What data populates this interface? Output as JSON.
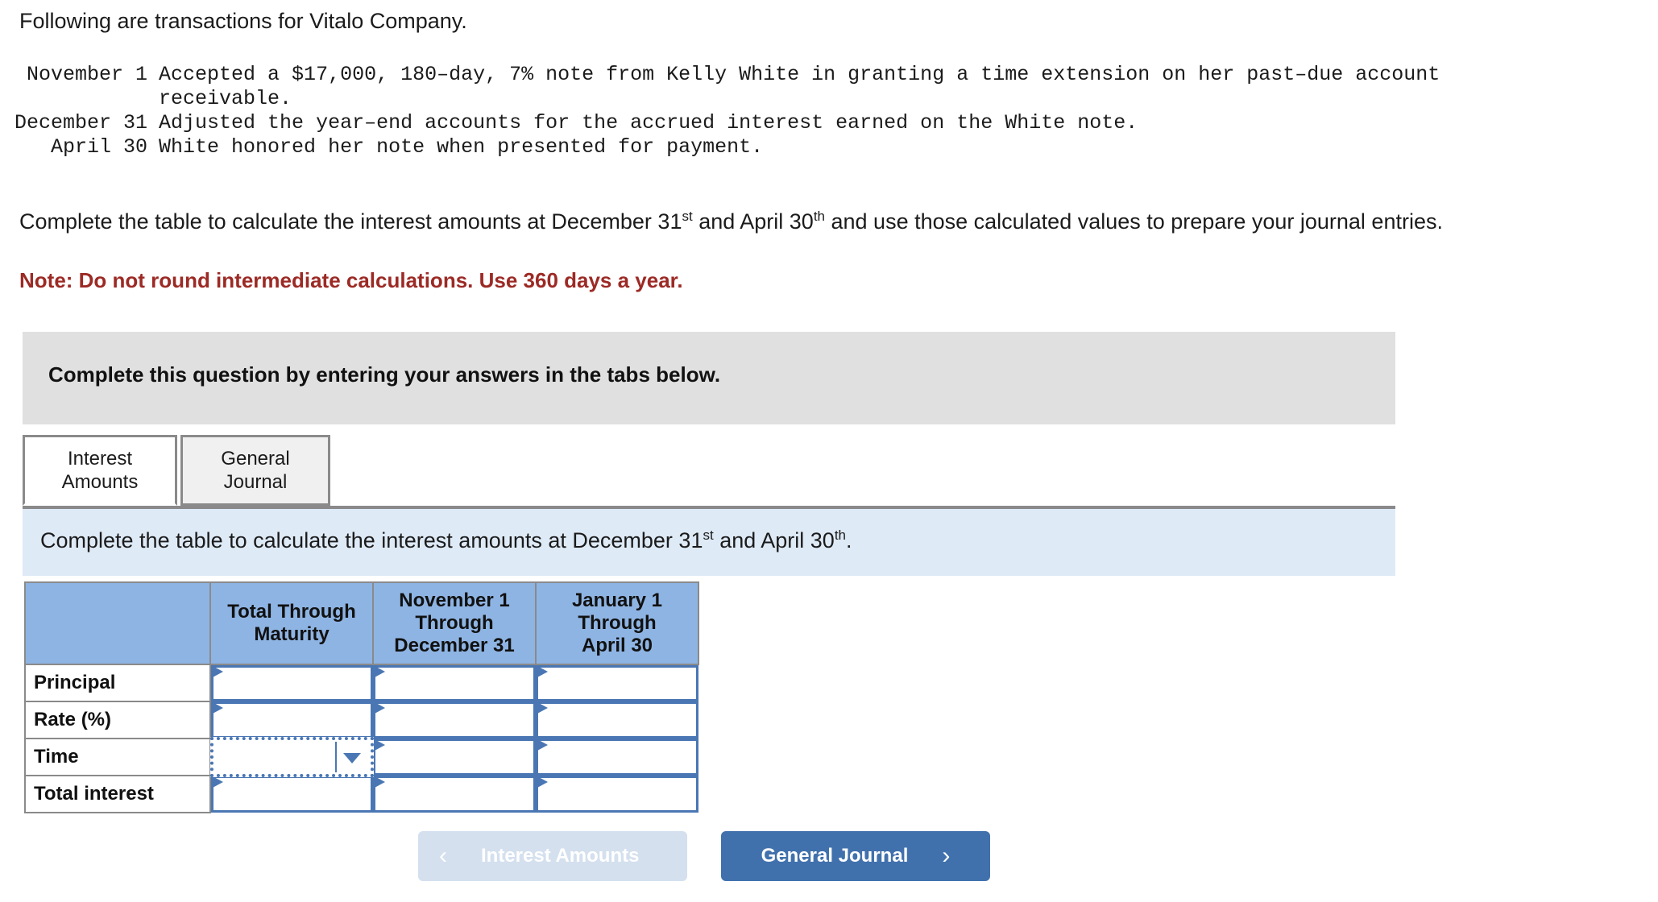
{
  "intro": "Following are transactions for Vitalo Company.",
  "transactions": [
    {
      "date": "November 1",
      "description": "Accepted a $17,000, 180–day, 7% note from Kelly White in granting a time extension on her past–due account",
      "description_line2": "receivable."
    },
    {
      "date": "December 31",
      "description": "Adjusted the year–end accounts for the accrued interest earned on the White note.",
      "description_line2": ""
    },
    {
      "date": "April 30",
      "description": "White honored her note when presented for payment.",
      "description_line2": ""
    }
  ],
  "requirement": {
    "part1": "Complete the table to calculate the interest amounts at December 31",
    "sup1": "st",
    "part2": " and April 30",
    "sup2": "th",
    "part3": " and use those calculated values to prepare your journal entries.",
    "note": "Note: Do not round intermediate calculations. Use 360 days a year.",
    "note_color": "#9c2a25"
  },
  "gray_banner": {
    "text": "Complete this question by entering your answers in the tabs below."
  },
  "tabs": [
    {
      "label_line1": "Interest",
      "label_line2": "Amounts",
      "active": true
    },
    {
      "label_line1": "General",
      "label_line2": "Journal",
      "active": false
    }
  ],
  "blue_bar": {
    "part1": "Complete the table to calculate the interest amounts at December 31",
    "sup1": "st",
    "part2": " and April 30",
    "sup2": "th",
    "part3": "."
  },
  "answer_table": {
    "header_color": "#8eb4e3",
    "headers": [
      "",
      "Total Through Maturity",
      "November 1 Through December 31",
      "January 1 Through April 30"
    ],
    "headers_wrapped": [
      {
        "l1": "",
        "l2": "",
        "l3": ""
      },
      {
        "l1": "Total Through",
        "l2": "Maturity",
        "l3": ""
      },
      {
        "l1": "November 1",
        "l2": "Through",
        "l3": "December 31"
      },
      {
        "l1": "January 1",
        "l2": "Through",
        "l3": "April 30"
      }
    ],
    "rows": [
      {
        "label": "Principal",
        "values": [
          "",
          "",
          ""
        ],
        "dropdown_col": -1
      },
      {
        "label": "Rate (%)",
        "values": [
          "",
          "",
          ""
        ],
        "dropdown_col": -1
      },
      {
        "label": "Time",
        "values": [
          "",
          "",
          ""
        ],
        "dropdown_col": 0
      },
      {
        "label": "Total interest",
        "values": [
          "",
          "",
          ""
        ],
        "dropdown_col": -1
      }
    ]
  },
  "nav": {
    "prev_label": "Interest Amounts",
    "prev_icon": "chevron-left-icon",
    "prev_glyph": "‹",
    "prev_disabled": true,
    "next_label": "General Journal",
    "next_icon": "chevron-right-icon",
    "next_glyph": "›",
    "next_color": "#4171ad"
  }
}
